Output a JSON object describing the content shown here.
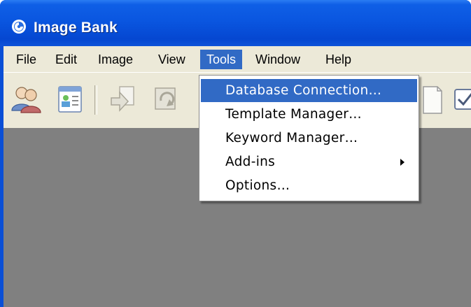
{
  "window": {
    "title": "Image Bank",
    "app_icon": "image-bank-app-icon"
  },
  "menubar": {
    "items": [
      {
        "label": "File"
      },
      {
        "label": "Edit"
      },
      {
        "label": "Image"
      },
      {
        "label": "View"
      },
      {
        "label": "Tools",
        "active": true
      },
      {
        "label": "Window"
      },
      {
        "label": "Help"
      }
    ]
  },
  "toolbar": {
    "buttons": [
      {
        "icon": "users-icon"
      },
      {
        "icon": "contact-card-icon"
      },
      {
        "icon": "import-arrow-icon"
      },
      {
        "icon": "refresh-import-icon"
      },
      {
        "icon": "document-icon"
      },
      {
        "icon": "checkbox-icon"
      }
    ]
  },
  "tools_menu": {
    "items": [
      {
        "label": "Database Connection…",
        "selected": true
      },
      {
        "label": "Template Manager…"
      },
      {
        "label": "Keyword Manager…"
      },
      {
        "label": "Add-ins",
        "submenu": true
      },
      {
        "label": "Options…"
      }
    ]
  },
  "colors": {
    "titlebar": "#0a56e0",
    "menu_face": "#ece9d8",
    "highlight": "#316ac5",
    "workspace": "#808080"
  }
}
